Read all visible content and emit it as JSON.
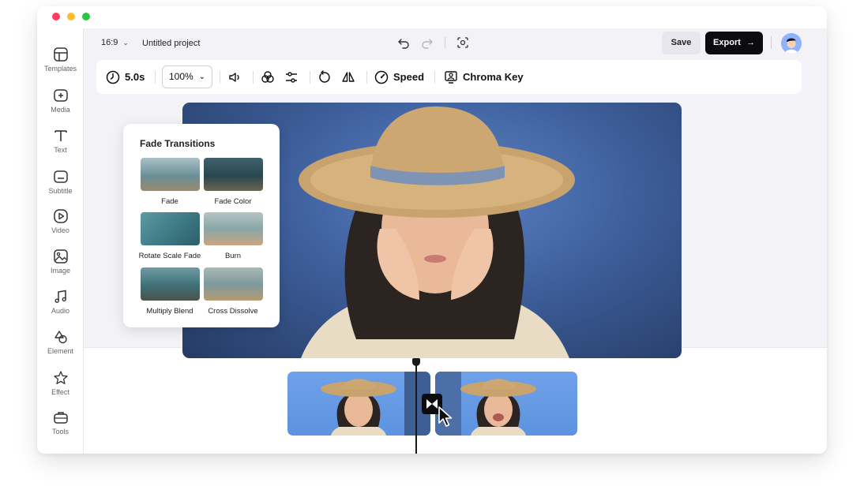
{
  "window": {
    "traffic_lights": [
      "close",
      "minimize",
      "maximize"
    ]
  },
  "sidebar": {
    "items": [
      {
        "label": "Templates",
        "icon": "templates-icon"
      },
      {
        "label": "Media",
        "icon": "media-icon"
      },
      {
        "label": "Text",
        "icon": "text-icon"
      },
      {
        "label": "Subtitle",
        "icon": "subtitle-icon"
      },
      {
        "label": "Video",
        "icon": "video-icon"
      },
      {
        "label": "Image",
        "icon": "image-icon"
      },
      {
        "label": "Audio",
        "icon": "audio-icon"
      },
      {
        "label": "Element",
        "icon": "element-icon"
      },
      {
        "label": "Effect",
        "icon": "effect-icon"
      },
      {
        "label": "Tools",
        "icon": "tools-icon"
      }
    ]
  },
  "header": {
    "aspect_ratio": "16:9",
    "project_name": "Untitled project",
    "save_label": "Save",
    "export_label": "Export"
  },
  "toolbar": {
    "duration": "5.0s",
    "zoom": "100%",
    "speed_label": "Speed",
    "chroma_label": "Chroma Key"
  },
  "transitions_panel": {
    "title": "Fade Transitions",
    "items": [
      {
        "label": "Fade"
      },
      {
        "label": "Fade Color"
      },
      {
        "label": "Rotate Scale Fade"
      },
      {
        "label": "Burn"
      },
      {
        "label": "Multiply Blend"
      },
      {
        "label": "Cross Dissolve"
      }
    ]
  },
  "colors": {
    "accent_dark": "#0c0c10",
    "preview_bg": "#3e5f9c",
    "clip_bg": "#6ea1e8",
    "red_light": "#ff3b5c",
    "yellow_light": "#ffbd2e",
    "green_light": "#28c940"
  }
}
